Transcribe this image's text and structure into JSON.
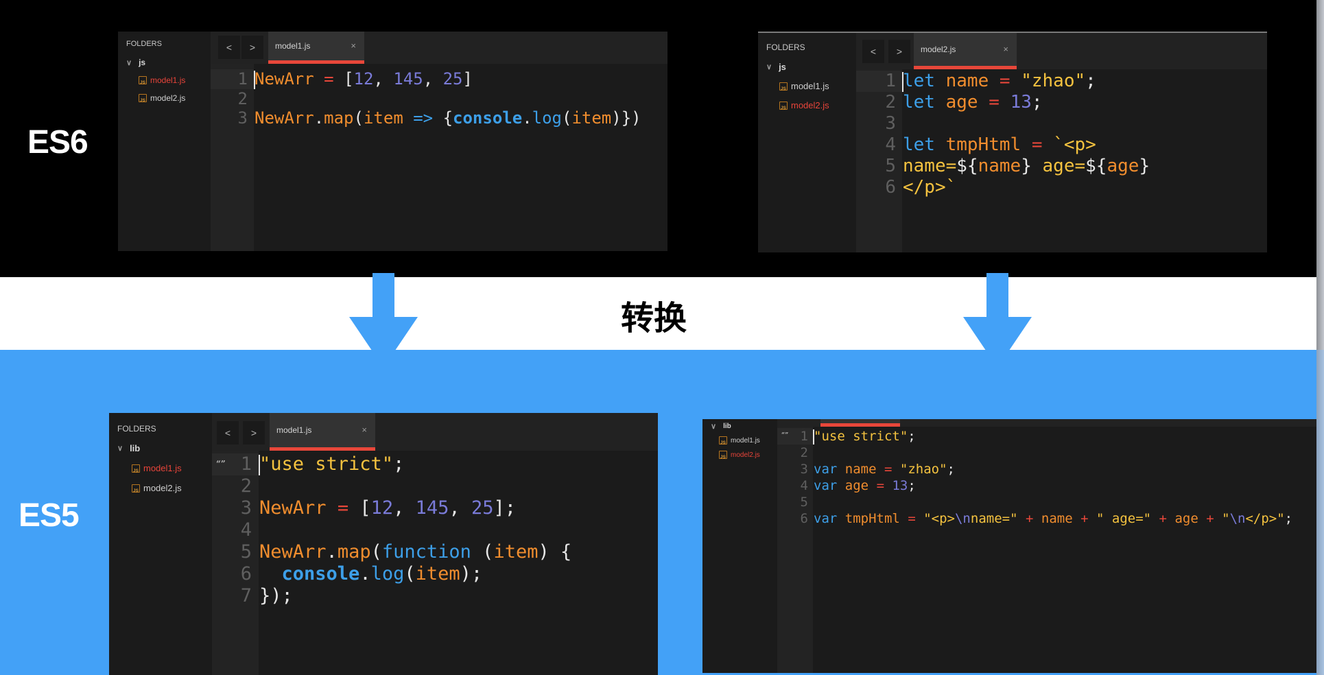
{
  "labels": {
    "es6": "ES6",
    "es5": "ES5",
    "transform": "转换"
  },
  "colors": {
    "accent_blue": "#43a1f7",
    "tab_underline": "#e8473a",
    "active_file": "#e8443a"
  },
  "panels": {
    "es6_model1": {
      "folders_title": "FOLDERS",
      "folder": "js",
      "files": [
        {
          "name": "model1.js",
          "active": true
        },
        {
          "name": "model2.js",
          "active": false
        }
      ],
      "nav_prev": "<",
      "nav_next": ">",
      "tab_label": "model1.js",
      "tab_close": "×",
      "lines": [
        {
          "num": "1",
          "tokens": [
            [
              "t-var",
              "NewArr"
            ],
            [
              "t-plain",
              " "
            ],
            [
              "t-op",
              "="
            ],
            [
              "t-plain",
              " "
            ],
            [
              "t-punc",
              "["
            ],
            [
              "t-num",
              "12"
            ],
            [
              "t-punc",
              ", "
            ],
            [
              "t-num",
              "145"
            ],
            [
              "t-punc",
              ", "
            ],
            [
              "t-num",
              "25"
            ],
            [
              "t-punc",
              "]"
            ]
          ]
        },
        {
          "num": "2",
          "tokens": []
        },
        {
          "num": "3",
          "tokens": [
            [
              "t-var",
              "NewArr"
            ],
            [
              "t-punc",
              "."
            ],
            [
              "t-fn",
              "map"
            ],
            [
              "t-punc",
              "("
            ],
            [
              "t-var",
              "item"
            ],
            [
              "t-plain",
              " "
            ],
            [
              "t-kw",
              "=>"
            ],
            [
              "t-plain",
              " "
            ],
            [
              "t-punc",
              "{"
            ],
            [
              "t-builtin",
              "console"
            ],
            [
              "t-punc",
              "."
            ],
            [
              "t-kw",
              "log"
            ],
            [
              "t-punc",
              "("
            ],
            [
              "t-var",
              "item"
            ],
            [
              "t-punc",
              ")})"
            ]
          ]
        }
      ]
    },
    "es6_model2": {
      "folders_title": "FOLDERS",
      "folder": "js",
      "files": [
        {
          "name": "model1.js",
          "active": false
        },
        {
          "name": "model2.js",
          "active": true
        }
      ],
      "nav_prev": "<",
      "nav_next": ">",
      "tab_label": "model2.js",
      "tab_close": "×",
      "lines": [
        {
          "num": "1",
          "tokens": [
            [
              "t-kw",
              "let"
            ],
            [
              "t-plain",
              " "
            ],
            [
              "t-var",
              "name"
            ],
            [
              "t-plain",
              " "
            ],
            [
              "t-op",
              "="
            ],
            [
              "t-plain",
              " "
            ],
            [
              "t-str",
              "\"zhao\""
            ],
            [
              "t-punc",
              ";"
            ]
          ]
        },
        {
          "num": "2",
          "tokens": [
            [
              "t-kw",
              "let"
            ],
            [
              "t-plain",
              " "
            ],
            [
              "t-var",
              "age"
            ],
            [
              "t-plain",
              " "
            ],
            [
              "t-op",
              "="
            ],
            [
              "t-plain",
              " "
            ],
            [
              "t-num",
              "13"
            ],
            [
              "t-punc",
              ";"
            ]
          ]
        },
        {
          "num": "3",
          "tokens": []
        },
        {
          "num": "4",
          "tokens": [
            [
              "t-kw",
              "let"
            ],
            [
              "t-plain",
              " "
            ],
            [
              "t-var",
              "tmpHtml"
            ],
            [
              "t-plain",
              " "
            ],
            [
              "t-op",
              "="
            ],
            [
              "t-plain",
              " "
            ],
            [
              "t-tpl",
              "`<p>"
            ]
          ]
        },
        {
          "num": "5",
          "tokens": [
            [
              "t-tpl",
              "name="
            ],
            [
              "t-punc",
              "${"
            ],
            [
              "t-var",
              "name"
            ],
            [
              "t-punc",
              "}"
            ],
            [
              "t-tpl",
              " age="
            ],
            [
              "t-punc",
              "${"
            ],
            [
              "t-var",
              "age"
            ],
            [
              "t-punc",
              "}"
            ]
          ]
        },
        {
          "num": "6",
          "tokens": [
            [
              "t-tpl",
              "</p>`"
            ]
          ]
        }
      ]
    },
    "es5_model1": {
      "folders_title": "FOLDERS",
      "folder": "lib",
      "files": [
        {
          "name": "model1.js",
          "active": true
        },
        {
          "name": "model2.js",
          "active": false
        }
      ],
      "nav_prev": "<",
      "nav_next": ">",
      "tab_label": "model1.js",
      "tab_close": "×",
      "quote_marker": "“”",
      "lines": [
        {
          "num": "1",
          "tokens": [
            [
              "t-str",
              "\"use strict\""
            ],
            [
              "t-punc",
              ";"
            ]
          ]
        },
        {
          "num": "2",
          "tokens": []
        },
        {
          "num": "3",
          "tokens": [
            [
              "t-var",
              "NewArr"
            ],
            [
              "t-plain",
              " "
            ],
            [
              "t-op",
              "="
            ],
            [
              "t-plain",
              " "
            ],
            [
              "t-punc",
              "["
            ],
            [
              "t-num",
              "12"
            ],
            [
              "t-punc",
              ", "
            ],
            [
              "t-num",
              "145"
            ],
            [
              "t-punc",
              ", "
            ],
            [
              "t-num",
              "25"
            ],
            [
              "t-punc",
              "];"
            ]
          ]
        },
        {
          "num": "4",
          "tokens": []
        },
        {
          "num": "5",
          "tokens": [
            [
              "t-var",
              "NewArr"
            ],
            [
              "t-punc",
              "."
            ],
            [
              "t-fn",
              "map"
            ],
            [
              "t-punc",
              "("
            ],
            [
              "t-kw",
              "function"
            ],
            [
              "t-plain",
              " "
            ],
            [
              "t-punc",
              "("
            ],
            [
              "t-var",
              "item"
            ],
            [
              "t-punc",
              ") {"
            ]
          ]
        },
        {
          "num": "6",
          "tokens": [
            [
              "t-plain",
              "  "
            ],
            [
              "t-builtin",
              "console"
            ],
            [
              "t-punc",
              "."
            ],
            [
              "t-kw",
              "log"
            ],
            [
              "t-punc",
              "("
            ],
            [
              "t-var",
              "item"
            ],
            [
              "t-punc",
              ");"
            ]
          ]
        },
        {
          "num": "7",
          "tokens": [
            [
              "t-punc",
              "});"
            ]
          ]
        }
      ]
    },
    "es5_model2": {
      "folder": "lib",
      "files": [
        {
          "name": "model1.js",
          "active": false
        },
        {
          "name": "model2.js",
          "active": true
        }
      ],
      "quote_marker": "“”",
      "lines": [
        {
          "num": "1",
          "tokens": [
            [
              "t-str",
              "\"use strict\""
            ],
            [
              "t-punc",
              ";"
            ]
          ]
        },
        {
          "num": "2",
          "tokens": []
        },
        {
          "num": "3",
          "tokens": [
            [
              "t-kw",
              "var"
            ],
            [
              "t-plain",
              " "
            ],
            [
              "t-var",
              "name"
            ],
            [
              "t-plain",
              " "
            ],
            [
              "t-op",
              "="
            ],
            [
              "t-plain",
              " "
            ],
            [
              "t-str",
              "\"zhao\""
            ],
            [
              "t-punc",
              ";"
            ]
          ]
        },
        {
          "num": "4",
          "tokens": [
            [
              "t-kw",
              "var"
            ],
            [
              "t-plain",
              " "
            ],
            [
              "t-var",
              "age"
            ],
            [
              "t-plain",
              " "
            ],
            [
              "t-op",
              "="
            ],
            [
              "t-plain",
              " "
            ],
            [
              "t-num",
              "13"
            ],
            [
              "t-punc",
              ";"
            ]
          ]
        },
        {
          "num": "5",
          "tokens": []
        },
        {
          "num": "6",
          "tokens": [
            [
              "t-kw",
              "var"
            ],
            [
              "t-plain",
              " "
            ],
            [
              "t-var",
              "tmpHtml"
            ],
            [
              "t-plain",
              " "
            ],
            [
              "t-op",
              "="
            ],
            [
              "t-plain",
              " "
            ],
            [
              "t-str",
              "\"<p>"
            ],
            [
              "t-esc",
              "\\n"
            ],
            [
              "t-str",
              "name=\""
            ],
            [
              "t-plain",
              " "
            ],
            [
              "t-op",
              "+"
            ],
            [
              "t-plain",
              " "
            ],
            [
              "t-var",
              "name"
            ],
            [
              "t-plain",
              " "
            ],
            [
              "t-op",
              "+"
            ],
            [
              "t-plain",
              " "
            ],
            [
              "t-str",
              "\" age=\""
            ],
            [
              "t-plain",
              " "
            ],
            [
              "t-op",
              "+"
            ],
            [
              "t-plain",
              " "
            ],
            [
              "t-var",
              "age"
            ],
            [
              "t-plain",
              " "
            ],
            [
              "t-op",
              "+"
            ],
            [
              "t-plain",
              " "
            ],
            [
              "t-str",
              "\""
            ],
            [
              "t-esc",
              "\\n"
            ],
            [
              "t-str",
              "</p>\""
            ],
            [
              "t-punc",
              ";"
            ]
          ]
        }
      ]
    }
  }
}
